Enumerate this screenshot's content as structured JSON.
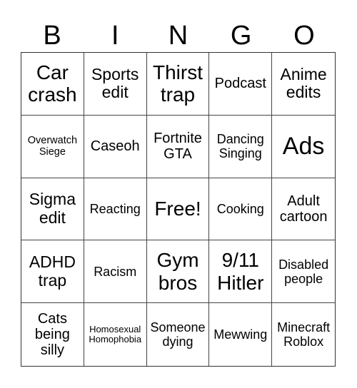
{
  "header": {
    "letters": [
      "B",
      "I",
      "N",
      "G",
      "O"
    ]
  },
  "cells": [
    "Car crash",
    "Sports edit",
    "Thirst trap",
    "Podcast",
    "Anime edits",
    "Overwatch Siege",
    "Caseoh",
    "Fortnite GTA",
    "Dancing Singing",
    "Ads",
    "Sigma edit",
    "Reacting",
    "Free!",
    "Cooking",
    "Adult cartoon",
    "ADHD trap",
    "Racism",
    "Gym bros",
    "9/11 Hitler",
    "Disabled people",
    "Cats being silly",
    "Homosexual Homophobia",
    "Someone dying",
    "Mewwing",
    "Minecraft Roblox"
  ]
}
